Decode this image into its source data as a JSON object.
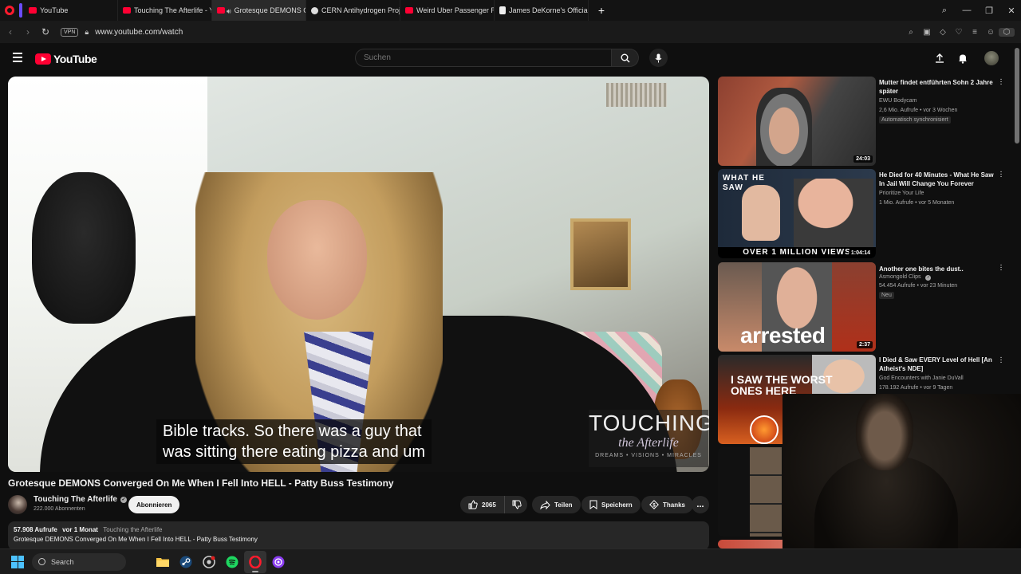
{
  "browser": {
    "tabs": [
      {
        "label": "YouTube",
        "icon": "youtube-icon",
        "active": false
      },
      {
        "label": "Touching The Afterlife - Yo",
        "icon": "youtube-icon",
        "active": false
      },
      {
        "label": "Grotesque DEMONS C",
        "icon": "speaker-icon",
        "active": true
      },
      {
        "label": "CERN Antihydrogen Proje",
        "icon": "cern-icon",
        "active": false
      },
      {
        "label": "Weird Uber Passenger Ret",
        "icon": "youtube-icon",
        "active": false
      },
      {
        "label": "James DeKorne's Official W",
        "icon": "document-icon",
        "active": false
      }
    ],
    "vpn_label": "VPN",
    "url": "www.youtube.com/watch"
  },
  "youtube": {
    "logo_text": "YouTube",
    "search_placeholder": "Suchen",
    "video": {
      "caption_line1": "Bible tracks. So there was a guy that",
      "caption_line2": "was sitting there eating pizza and um",
      "watermark_main": "TOUCHING",
      "watermark_sub": "the Afterlife",
      "watermark_tag": "DREAMS • VISIONS • MIRACLES"
    },
    "title": "Grotesque DEMONS Converged On Me When I Fell Into HELL - Patty Buss Testimony",
    "channel": {
      "name": "Touching The Afterlife",
      "subscribers": "222.000 Abonnenten",
      "subscribe_label": "Abonnieren"
    },
    "actions": {
      "likes": "2065",
      "share": "Teilen",
      "save": "Speichern",
      "thanks": "Thanks",
      "more": "..."
    },
    "description": {
      "views": "57.908 Aufrufe",
      "age": "vor 1 Monat",
      "tag": "Touching the Afterlife",
      "text": "Grotesque DEMONS Converged On Me When I Fell Into HELL - Patty Buss Testimony"
    },
    "recommendations": [
      {
        "title": "Mutter findet entführten Sohn 2 Jahre später",
        "channel": "EWU Bodycam",
        "stats": "2,6 Mio. Aufrufe • vor 3 Wochen",
        "badge": "Automatisch synchronisiert",
        "duration": "24:03"
      },
      {
        "title": "He Died for 40 Minutes - What He Saw In Jail Will Change You Forever",
        "channel": "Prioritize Your Life",
        "stats": "1 Mio. Aufrufe • vor 5 Monaten",
        "thumb_text_top": "WHAT HE SAW",
        "thumb_text_bottom": "OVER 1 MILLION VIEWS",
        "duration": "1:04:14"
      },
      {
        "title": "Another one bites the dust..",
        "channel": "Asmongold Clips",
        "stats": "54.454 Aufrufe • vor 23 Minuten",
        "badge": "Neu",
        "thumb_text": "arrested",
        "duration": "2:37"
      },
      {
        "title": "I Died & Saw EVERY Level of Hell [An Atheist's NDE]",
        "channel": "God Encounters with Janie DuVall",
        "stats": "178.192 Aufrufe • vor 9 Tagen",
        "thumb_text": "I SAW THE WORST ONES HERE"
      }
    ]
  },
  "taskbar": {
    "search_label": "Search"
  }
}
